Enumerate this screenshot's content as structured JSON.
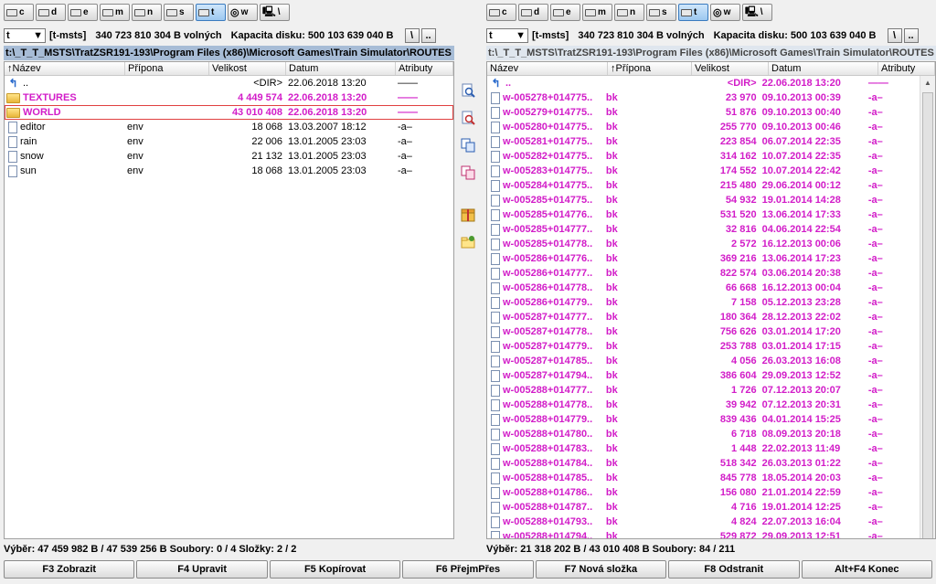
{
  "left": {
    "drives": [
      "c",
      "d",
      "e",
      "m",
      "n",
      "s",
      "t",
      "w",
      ""
    ],
    "selected_drive": "t",
    "combo": "t",
    "volume": "[t-msts]",
    "free": "340 723 810 304 B volných",
    "capacity": "Kapacita disku: 500 103 639 040 B",
    "root_btn": "\\",
    "up_btn": "..",
    "path": "t:\\_T_T_MSTS\\TratZSR191-193\\Program Files (x86)\\Microsoft Games\\Train Simulator\\ROUTES",
    "headers": {
      "name": "Název",
      "ext": "Přípona",
      "size": "Velikost",
      "date": "Datum",
      "attr": "Atributy"
    },
    "rows": [
      {
        "name": "..",
        "ext": "",
        "size": "<DIR>",
        "date": "22.06.2018 13:20",
        "attr": "——",
        "icon": "back-icon",
        "color": "dark"
      },
      {
        "name": "TEXTURES",
        "ext": "",
        "size": "4 449 574",
        "date": "22.06.2018 13:20",
        "attr": "——",
        "icon": "folder-icon",
        "color": "pink"
      },
      {
        "name": "WORLD",
        "ext": "",
        "size": "43 010 408",
        "date": "22.06.2018 13:20",
        "attr": "——",
        "icon": "folder-icon",
        "color": "pink",
        "selected": true
      },
      {
        "name": "editor",
        "ext": "env",
        "size": "18 068",
        "date": "13.03.2007 18:12",
        "attr": "-a–",
        "icon": "file-icon",
        "color": "dark"
      },
      {
        "name": "rain",
        "ext": "env",
        "size": "22 006",
        "date": "13.01.2005 23:03",
        "attr": "-a–",
        "icon": "file-icon",
        "color": "dark"
      },
      {
        "name": "snow",
        "ext": "env",
        "size": "21 132",
        "date": "13.01.2005 23:03",
        "attr": "-a–",
        "icon": "file-icon",
        "color": "dark"
      },
      {
        "name": "sun",
        "ext": "env",
        "size": "18 068",
        "date": "13.01.2005 23:03",
        "attr": "-a–",
        "icon": "file-icon",
        "color": "dark"
      }
    ],
    "status": "Výběr: 47 459 982 B / 47 539 256 B  Soubory: 0 / 4  Složky: 2 / 2"
  },
  "right": {
    "drives": [
      "c",
      "d",
      "e",
      "m",
      "n",
      "s",
      "t",
      "w",
      ""
    ],
    "selected_drive": "t",
    "combo": "t",
    "volume": "[t-msts]",
    "free": "340 723 810 304 B volných",
    "capacity": "Kapacita disku: 500 103 639 040 B",
    "root_btn": "\\",
    "up_btn": "..",
    "path": "t:\\_T_T_MSTS\\TratZSR191-193\\Program Files (x86)\\Microsoft Games\\Train Simulator\\ROUTES",
    "headers": {
      "name": "Název",
      "ext": "Přípona",
      "size": "Velikost",
      "date": "Datum",
      "attr": "Atributy"
    },
    "rows": [
      {
        "name": "..",
        "ext": "",
        "size": "<DIR>",
        "date": "22.06.2018 13:20",
        "attr": "——",
        "icon": "back-icon",
        "color": "pink"
      },
      {
        "name": "w-005278+014775..",
        "ext": "bk",
        "size": "23 970",
        "date": "09.10.2013 00:39",
        "attr": "-a–",
        "icon": "file-icon",
        "color": "pink"
      },
      {
        "name": "w-005279+014775..",
        "ext": "bk",
        "size": "51 876",
        "date": "09.10.2013 00:40",
        "attr": "-a–",
        "icon": "file-icon",
        "color": "pink"
      },
      {
        "name": "w-005280+014775..",
        "ext": "bk",
        "size": "255 770",
        "date": "09.10.2013 00:46",
        "attr": "-a–",
        "icon": "file-icon",
        "color": "pink"
      },
      {
        "name": "w-005281+014775..",
        "ext": "bk",
        "size": "223 854",
        "date": "06.07.2014 22:35",
        "attr": "-a–",
        "icon": "file-icon",
        "color": "pink"
      },
      {
        "name": "w-005282+014775..",
        "ext": "bk",
        "size": "314 162",
        "date": "10.07.2014 22:35",
        "attr": "-a–",
        "icon": "file-icon",
        "color": "pink"
      },
      {
        "name": "w-005283+014775..",
        "ext": "bk",
        "size": "174 552",
        "date": "10.07.2014 22:42",
        "attr": "-a–",
        "icon": "file-icon",
        "color": "pink"
      },
      {
        "name": "w-005284+014775..",
        "ext": "bk",
        "size": "215 480",
        "date": "29.06.2014 00:12",
        "attr": "-a–",
        "icon": "file-icon",
        "color": "pink"
      },
      {
        "name": "w-005285+014775..",
        "ext": "bk",
        "size": "54 932",
        "date": "19.01.2014 14:28",
        "attr": "-a–",
        "icon": "file-icon",
        "color": "pink"
      },
      {
        "name": "w-005285+014776..",
        "ext": "bk",
        "size": "531 520",
        "date": "13.06.2014 17:33",
        "attr": "-a–",
        "icon": "file-icon",
        "color": "pink"
      },
      {
        "name": "w-005285+014777..",
        "ext": "bk",
        "size": "32 816",
        "date": "04.06.2014 22:54",
        "attr": "-a–",
        "icon": "file-icon",
        "color": "pink"
      },
      {
        "name": "w-005285+014778..",
        "ext": "bk",
        "size": "2 572",
        "date": "16.12.2013 00:06",
        "attr": "-a–",
        "icon": "file-icon",
        "color": "pink"
      },
      {
        "name": "w-005286+014776..",
        "ext": "bk",
        "size": "369 216",
        "date": "13.06.2014 17:23",
        "attr": "-a–",
        "icon": "file-icon",
        "color": "pink"
      },
      {
        "name": "w-005286+014777..",
        "ext": "bk",
        "size": "822 574",
        "date": "03.06.2014 20:38",
        "attr": "-a–",
        "icon": "file-icon",
        "color": "pink"
      },
      {
        "name": "w-005286+014778..",
        "ext": "bk",
        "size": "66 668",
        "date": "16.12.2013 00:04",
        "attr": "-a–",
        "icon": "file-icon",
        "color": "pink"
      },
      {
        "name": "w-005286+014779..",
        "ext": "bk",
        "size": "7 158",
        "date": "05.12.2013 23:28",
        "attr": "-a–",
        "icon": "file-icon",
        "color": "pink"
      },
      {
        "name": "w-005287+014777..",
        "ext": "bk",
        "size": "180 364",
        "date": "28.12.2013 22:02",
        "attr": "-a–",
        "icon": "file-icon",
        "color": "pink"
      },
      {
        "name": "w-005287+014778..",
        "ext": "bk",
        "size": "756 626",
        "date": "03.01.2014 17:20",
        "attr": "-a–",
        "icon": "file-icon",
        "color": "pink"
      },
      {
        "name": "w-005287+014779..",
        "ext": "bk",
        "size": "253 788",
        "date": "03.01.2014 17:15",
        "attr": "-a–",
        "icon": "file-icon",
        "color": "pink"
      },
      {
        "name": "w-005287+014785..",
        "ext": "bk",
        "size": "4 056",
        "date": "26.03.2013 16:08",
        "attr": "-a–",
        "icon": "file-icon",
        "color": "pink"
      },
      {
        "name": "w-005287+014794..",
        "ext": "bk",
        "size": "386 604",
        "date": "29.09.2013 12:52",
        "attr": "-a–",
        "icon": "file-icon",
        "color": "pink"
      },
      {
        "name": "w-005288+014777..",
        "ext": "bk",
        "size": "1 726",
        "date": "07.12.2013 20:07",
        "attr": "-a–",
        "icon": "file-icon",
        "color": "pink"
      },
      {
        "name": "w-005288+014778..",
        "ext": "bk",
        "size": "39 942",
        "date": "07.12.2013 20:31",
        "attr": "-a–",
        "icon": "file-icon",
        "color": "pink"
      },
      {
        "name": "w-005288+014779..",
        "ext": "bk",
        "size": "839 436",
        "date": "04.01.2014 15:25",
        "attr": "-a–",
        "icon": "file-icon",
        "color": "pink"
      },
      {
        "name": "w-005288+014780..",
        "ext": "bk",
        "size": "6 718",
        "date": "08.09.2013 20:18",
        "attr": "-a–",
        "icon": "file-icon",
        "color": "pink"
      },
      {
        "name": "w-005288+014783..",
        "ext": "bk",
        "size": "1 448",
        "date": "22.02.2013 11:49",
        "attr": "-a–",
        "icon": "file-icon",
        "color": "pink"
      },
      {
        "name": "w-005288+014784..",
        "ext": "bk",
        "size": "518 342",
        "date": "26.03.2013 01:22",
        "attr": "-a–",
        "icon": "file-icon",
        "color": "pink"
      },
      {
        "name": "w-005288+014785..",
        "ext": "bk",
        "size": "845 778",
        "date": "18.05.2014 20:03",
        "attr": "-a–",
        "icon": "file-icon",
        "color": "pink"
      },
      {
        "name": "w-005288+014786..",
        "ext": "bk",
        "size": "156 080",
        "date": "21.01.2014 22:59",
        "attr": "-a–",
        "icon": "file-icon",
        "color": "pink"
      },
      {
        "name": "w-005288+014787..",
        "ext": "bk",
        "size": "4 716",
        "date": "19.01.2014 12:25",
        "attr": "-a–",
        "icon": "file-icon",
        "color": "pink"
      },
      {
        "name": "w-005288+014793..",
        "ext": "bk",
        "size": "4 824",
        "date": "22.07.2013 16:04",
        "attr": "-a–",
        "icon": "file-icon",
        "color": "pink"
      },
      {
        "name": "w-005288+014794..",
        "ext": "bk",
        "size": "529 872",
        "date": "29.09.2013 12:51",
        "attr": "-a–",
        "icon": "file-icon",
        "color": "pink"
      }
    ],
    "status": "Výběr: 21 318 202 B / 43 010 408 B  Soubory: 84 / 211"
  },
  "fkeys": [
    "F3 Zobrazit",
    "F4 Upravit",
    "F5 Kopírovat",
    "F6 PřejmPřes",
    "F7 Nová složka",
    "F8 Odstranit",
    "Alt+F4 Konec"
  ],
  "colors": {
    "highlight": "#d21cc8",
    "path_bg": "#a7bcd6"
  }
}
